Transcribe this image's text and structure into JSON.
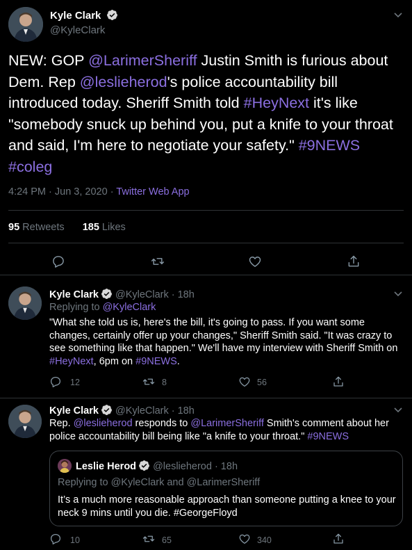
{
  "colors": {
    "background": "#000000",
    "link": "#8b6fe0",
    "verified": "#d9d9d9",
    "muted": "#6e767d"
  },
  "main_tweet": {
    "name": "Kyle Clark",
    "handle": "@KyleClark",
    "body": {
      "t1": "NEW: GOP ",
      "mention1": "@LarimerSheriff",
      "t2": " Justin Smith is furious about Dem. Rep ",
      "mention2": "@leslieherod",
      "t3": "'s police accountability bill introduced today. Sheriff Smith told ",
      "hashtag1": "#HeyNext",
      "t4": " it's like  \"somebody snuck up behind you, put a knife to your throat and said, I'm here to negotiate your safety.\" ",
      "hashtag2": "#9NEWS",
      "t5": " ",
      "hashtag3": "#coleg"
    },
    "timestamp": "4:24 PM · Jun 3, 2020 · ",
    "source": "Twitter Web App",
    "retweets_count": "95",
    "retweets_label": "Retweets",
    "likes_count": "185",
    "likes_label": "Likes",
    "actions": [
      "reply-icon",
      "retweet-icon",
      "like-icon",
      "share-icon"
    ]
  },
  "replies": [
    {
      "name": "Kyle Clark",
      "handle": "@KyleClark",
      "time": "· 18h",
      "replying_prefix": "Replying to ",
      "replying_to": "@KyleClark",
      "text": {
        "t1": "\"What she told us is, here's the bill, it's going to pass. If you want some changes, certainly offer up your changes,\" Sheriff  Smith said. \"It was crazy to see something like that happen.\" We'll have my interview with Sheriff Smith on ",
        "hashtag1": "#HeyNext",
        "t2": ", 6pm on ",
        "hashtag2": "#9NEWS",
        "t3": "."
      },
      "reply_count": "12",
      "retweet_count": "8",
      "like_count": "56"
    },
    {
      "name": "Kyle Clark",
      "handle": "@KyleClark",
      "time": "· 18h",
      "text": {
        "t1": "Rep. ",
        "mention1": "@leslieherod",
        "t2": " responds to ",
        "mention2": "@LarimerSheriff",
        "t3": " Smith's comment about her police accountability bill being like \"a knife to your throat.\" ",
        "hashtag1": "#9NEWS"
      },
      "quote": {
        "name": "Leslie Herod",
        "handle": "@leslieherod",
        "time": "· 18h",
        "replying": "Replying to @KyleClark and @LarimerSheriff",
        "text": "It’s a much more reasonable approach than someone putting a knee to your neck 9 mins until you die. #GeorgeFloyd"
      },
      "reply_count": "10",
      "retweet_count": "65",
      "like_count": "340"
    }
  ]
}
